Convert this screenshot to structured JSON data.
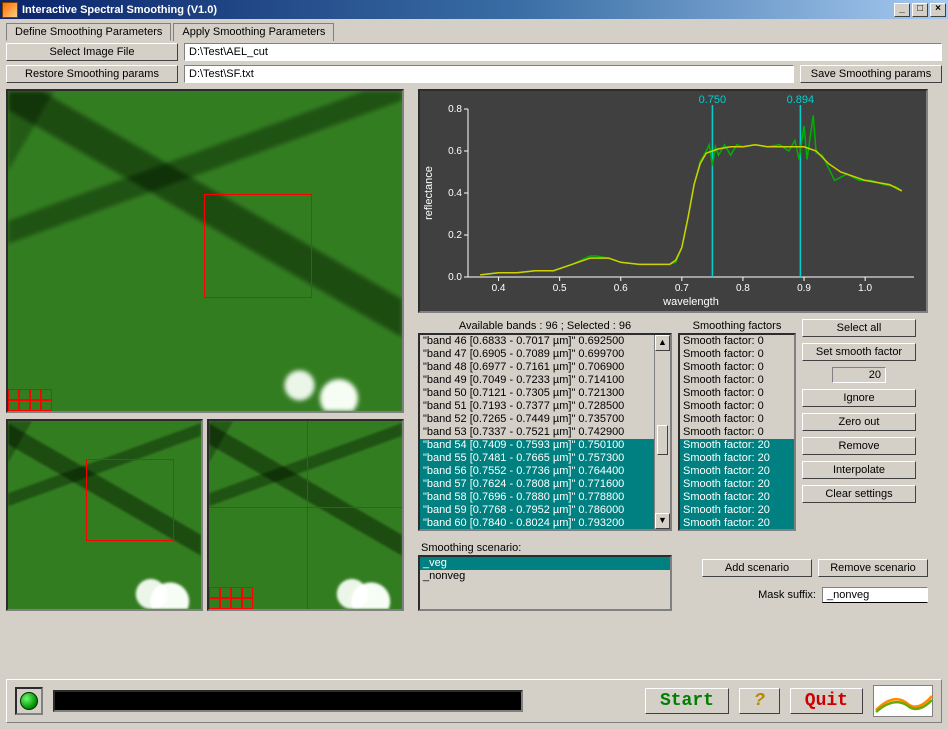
{
  "window": {
    "title": "Interactive Spectral Smoothing  (V1.0)",
    "min": "_",
    "max": "□",
    "close": "×"
  },
  "tabs": {
    "active": "Define Smoothing Parameters",
    "inactive": "Apply Smoothing Parameters"
  },
  "toolbar": {
    "select_image": "Select Image File",
    "image_path": "D:\\Test\\AEL_cut",
    "restore_params": "Restore Smoothing params",
    "params_path": "D:\\Test\\SF.txt",
    "save_params": "Save Smoothing params"
  },
  "lists": {
    "bands_header": "Available bands : 96 ; Selected : 96",
    "factors_header": "Smoothing factors",
    "bands": [
      {
        "t": "\"band 46 [0.6833 - 0.7017 µm]\"  0.692500",
        "s": false
      },
      {
        "t": "\"band 47 [0.6905 - 0.7089 µm]\"  0.699700",
        "s": false
      },
      {
        "t": "\"band 48 [0.6977 - 0.7161 µm]\"  0.706900",
        "s": false
      },
      {
        "t": "\"band 49 [0.7049 - 0.7233 µm]\"  0.714100",
        "s": false
      },
      {
        "t": "\"band 50 [0.7121 - 0.7305 µm]\"  0.721300",
        "s": false
      },
      {
        "t": "\"band 51 [0.7193 - 0.7377 µm]\"  0.728500",
        "s": false
      },
      {
        "t": "\"band 52 [0.7265 - 0.7449 µm]\"  0.735700",
        "s": false
      },
      {
        "t": "\"band 53 [0.7337 - 0.7521 µm]\"  0.742900",
        "s": false
      },
      {
        "t": "\"band 54 [0.7409 - 0.7593 µm]\"  0.750100",
        "s": true
      },
      {
        "t": "\"band 55 [0.7481 - 0.7665 µm]\"  0.757300",
        "s": true
      },
      {
        "t": "\"band 56 [0.7552 - 0.7736 µm]\"  0.764400",
        "s": true
      },
      {
        "t": "\"band 57 [0.7624 - 0.7808 µm]\"  0.771600",
        "s": true
      },
      {
        "t": "\"band 58 [0.7696 - 0.7880 µm]\"  0.778800",
        "s": true
      },
      {
        "t": "\"band 59 [0.7768 - 0.7952 µm]\"  0.786000",
        "s": true
      },
      {
        "t": "\"band 60 [0.7840 - 0.8024 µm]\"  0.793200",
        "s": true
      }
    ],
    "factors": [
      {
        "t": "Smooth factor: 0",
        "s": false
      },
      {
        "t": "Smooth factor: 0",
        "s": false
      },
      {
        "t": "Smooth factor: 0",
        "s": false
      },
      {
        "t": "Smooth factor: 0",
        "s": false
      },
      {
        "t": "Smooth factor: 0",
        "s": false
      },
      {
        "t": "Smooth factor: 0",
        "s": false
      },
      {
        "t": "Smooth factor: 0",
        "s": false
      },
      {
        "t": "Smooth factor: 0",
        "s": false
      },
      {
        "t": "Smooth factor: 20",
        "s": true
      },
      {
        "t": "Smooth factor: 20",
        "s": true
      },
      {
        "t": "Smooth factor: 20",
        "s": true
      },
      {
        "t": "Smooth factor: 20",
        "s": true
      },
      {
        "t": "Smooth factor: 20",
        "s": true
      },
      {
        "t": "Smooth factor: 20",
        "s": true
      },
      {
        "t": "Smooth factor: 20",
        "s": true
      }
    ]
  },
  "side": {
    "select_all": "Select all",
    "set_smooth": "Set smooth factor",
    "smooth_value": "20",
    "ignore": "Ignore",
    "zero_out": "Zero out",
    "remove": "Remove",
    "interpolate": "Interpolate",
    "clear": "Clear settings"
  },
  "scenario": {
    "header": "Smoothing scenario:",
    "items": [
      {
        "t": "_veg",
        "s": true
      },
      {
        "t": "_nonveg",
        "s": false
      }
    ],
    "add": "Add scenario",
    "remove": "Remove scenario",
    "mask_label": "Mask suffix:",
    "mask_value": "_nonveg"
  },
  "footer": {
    "start": "Start",
    "help": "?",
    "quit": "Quit"
  },
  "chart_data": {
    "type": "line",
    "title": "",
    "xlabel": "wavelength",
    "ylabel": "reflectance",
    "xlim": [
      0.35,
      1.08
    ],
    "ylim": [
      0.0,
      0.8
    ],
    "xticks": [
      0.4,
      0.5,
      0.6,
      0.7,
      0.8,
      0.9,
      1.0
    ],
    "yticks": [
      0.0,
      0.2,
      0.4,
      0.6,
      0.8
    ],
    "markers": [
      {
        "x": 0.75,
        "label": "0.750",
        "color": "#00d0d0"
      },
      {
        "x": 0.894,
        "label": "0.894",
        "color": "#00d0d0"
      }
    ],
    "series": [
      {
        "name": "raw",
        "color": "#00b000",
        "values": [
          [
            0.37,
            0.01
          ],
          [
            0.4,
            0.02
          ],
          [
            0.43,
            0.02
          ],
          [
            0.46,
            0.03
          ],
          [
            0.49,
            0.03
          ],
          [
            0.52,
            0.06
          ],
          [
            0.55,
            0.1
          ],
          [
            0.56,
            0.1
          ],
          [
            0.58,
            0.09
          ],
          [
            0.6,
            0.07
          ],
          [
            0.63,
            0.06
          ],
          [
            0.66,
            0.06
          ],
          [
            0.68,
            0.06
          ],
          [
            0.69,
            0.07
          ],
          [
            0.7,
            0.14
          ],
          [
            0.71,
            0.28
          ],
          [
            0.72,
            0.44
          ],
          [
            0.73,
            0.55
          ],
          [
            0.74,
            0.6
          ],
          [
            0.745,
            0.63
          ],
          [
            0.75,
            0.53
          ],
          [
            0.755,
            0.62
          ],
          [
            0.76,
            0.58
          ],
          [
            0.77,
            0.63
          ],
          [
            0.78,
            0.58
          ],
          [
            0.79,
            0.63
          ],
          [
            0.8,
            0.62
          ],
          [
            0.82,
            0.63
          ],
          [
            0.84,
            0.62
          ],
          [
            0.86,
            0.63
          ],
          [
            0.875,
            0.6
          ],
          [
            0.885,
            0.65
          ],
          [
            0.892,
            0.56
          ],
          [
            0.9,
            0.72
          ],
          [
            0.905,
            0.56
          ],
          [
            0.915,
            0.77
          ],
          [
            0.92,
            0.59
          ],
          [
            0.93,
            0.58
          ],
          [
            0.95,
            0.46
          ],
          [
            0.97,
            0.49
          ],
          [
            0.99,
            0.46
          ],
          [
            1.01,
            0.46
          ],
          [
            1.03,
            0.44
          ],
          [
            1.05,
            0.43
          ],
          [
            1.06,
            0.41
          ]
        ]
      },
      {
        "name": "smoothed",
        "color": "#d0d000",
        "values": [
          [
            0.37,
            0.01
          ],
          [
            0.4,
            0.02
          ],
          [
            0.43,
            0.02
          ],
          [
            0.46,
            0.03
          ],
          [
            0.49,
            0.03
          ],
          [
            0.52,
            0.06
          ],
          [
            0.55,
            0.09
          ],
          [
            0.58,
            0.09
          ],
          [
            0.6,
            0.07
          ],
          [
            0.63,
            0.06
          ],
          [
            0.66,
            0.06
          ],
          [
            0.68,
            0.06
          ],
          [
            0.69,
            0.08
          ],
          [
            0.7,
            0.14
          ],
          [
            0.71,
            0.28
          ],
          [
            0.72,
            0.44
          ],
          [
            0.73,
            0.54
          ],
          [
            0.74,
            0.59
          ],
          [
            0.75,
            0.6
          ],
          [
            0.76,
            0.61
          ],
          [
            0.78,
            0.62
          ],
          [
            0.8,
            0.62
          ],
          [
            0.82,
            0.63
          ],
          [
            0.84,
            0.62
          ],
          [
            0.86,
            0.62
          ],
          [
            0.88,
            0.62
          ],
          [
            0.9,
            0.62
          ],
          [
            0.92,
            0.6
          ],
          [
            0.94,
            0.54
          ],
          [
            0.96,
            0.5
          ],
          [
            0.98,
            0.48
          ],
          [
            1.0,
            0.46
          ],
          [
            1.02,
            0.45
          ],
          [
            1.04,
            0.44
          ],
          [
            1.06,
            0.41
          ]
        ]
      }
    ]
  }
}
